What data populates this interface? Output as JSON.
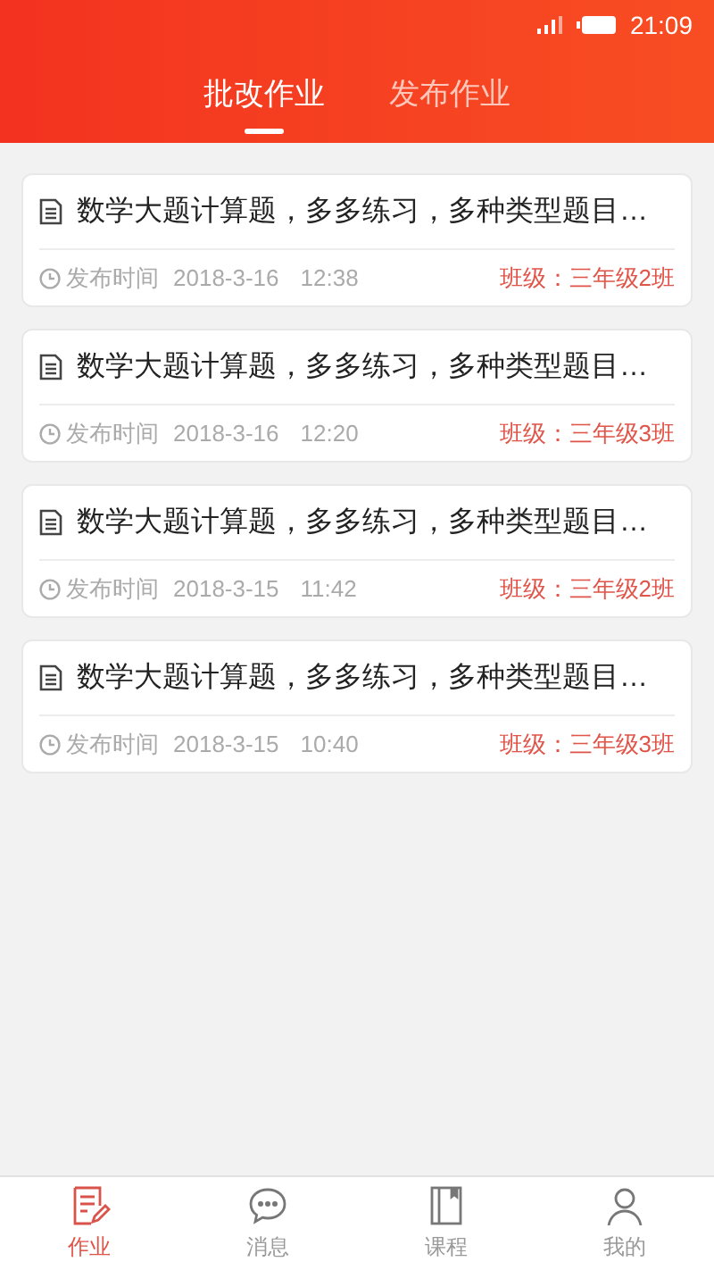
{
  "status_bar": {
    "time": "21:09"
  },
  "tabs": [
    {
      "label": "批改作业",
      "selected": true
    },
    {
      "label": "发布作业",
      "selected": false
    }
  ],
  "assignments": [
    {
      "title": "数学大题计算题，多多练习，多种类型题目…",
      "time_label": "发布时间",
      "date": "2018-3-16",
      "time": "12:38",
      "class": "班级：三年级2班"
    },
    {
      "title": "数学大题计算题，多多练习，多种类型题目…",
      "time_label": "发布时间",
      "date": "2018-3-16",
      "time": "12:20",
      "class": "班级：三年级3班"
    },
    {
      "title": "数学大题计算题，多多练习，多种类型题目…",
      "time_label": "发布时间",
      "date": "2018-3-15",
      "time": "11:42",
      "class": "班级：三年级2班"
    },
    {
      "title": "数学大题计算题，多多练习，多种类型题目…",
      "time_label": "发布时间",
      "date": "2018-3-15",
      "time": "10:40",
      "class": "班级：三年级3班"
    }
  ],
  "bottom_nav": [
    {
      "kind": "homework",
      "label": "作业",
      "selected": true
    },
    {
      "kind": "message",
      "label": "消息",
      "selected": false
    },
    {
      "kind": "course",
      "label": "课程",
      "selected": false
    },
    {
      "kind": "profile",
      "label": "我的",
      "selected": false
    }
  ]
}
